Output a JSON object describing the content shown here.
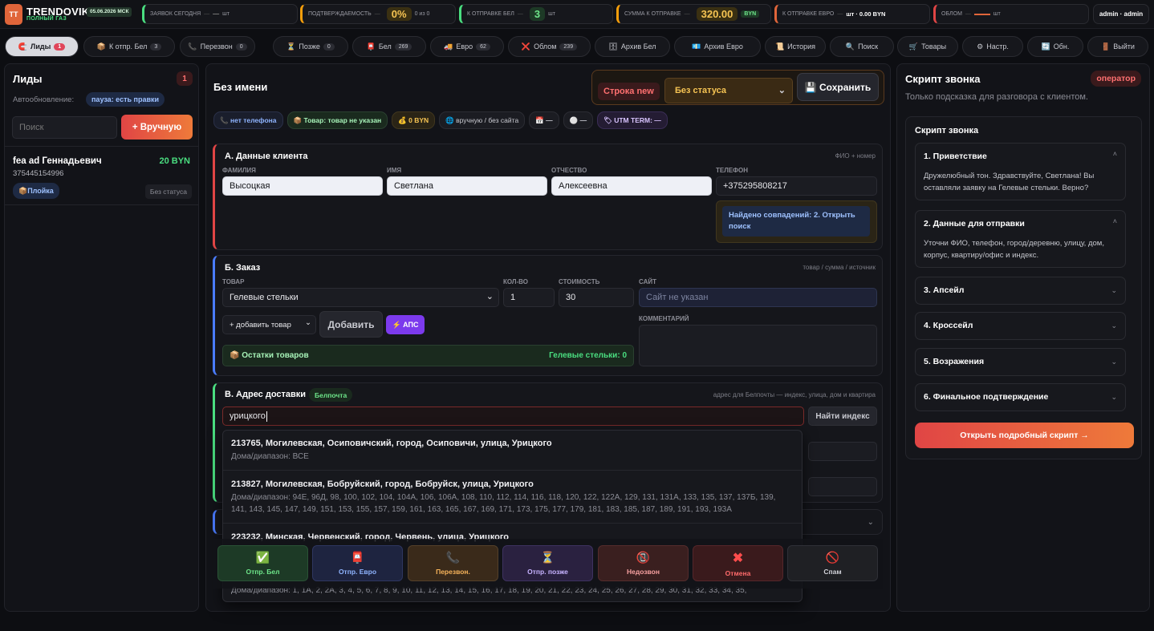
{
  "topbar": {
    "logo": "TT",
    "brand": "TRENDOVIK",
    "brand_sub": "ПОЛНЫЙ ГАЗ",
    "date": "05.06.2026 МСК",
    "stats": [
      {
        "label": "ЗАЯВОК СЕГОДНЯ",
        "value": "—",
        "unit": "шт"
      },
      {
        "label": "ПОДТВЕРЖДАЕМОСТЬ",
        "value": "0%",
        "unit": "0 из 0"
      },
      {
        "label": "К ОТПРАВКЕ БЕЛ",
        "value": "3",
        "unit": "шт"
      },
      {
        "label": "СУММА К ОТПРАВКЕ",
        "value": "320.00",
        "unit": "BYN"
      },
      {
        "label": "К ОТПРАВКЕ ЕВРО",
        "value": "шт · 0.00 BYN"
      },
      {
        "label": "ОБЛОМ",
        "value": "—",
        "unit": "шт"
      }
    ],
    "user": "admin · admin",
    "colors": {
      "green": "#4ade80",
      "orange": "#f59e0b",
      "red": "#e04545"
    }
  },
  "tabs": [
    {
      "icon": "🧲",
      "label": "Лиды",
      "count": "1"
    },
    {
      "icon": "📦",
      "label": "К отпр. Бел",
      "count": "3"
    },
    {
      "icon": "📞",
      "label": "Перезвон",
      "count": "0"
    },
    {
      "icon": "⏳",
      "label": "Позже",
      "count": "0"
    },
    {
      "icon": "📮",
      "label": "Бел",
      "count": "269"
    },
    {
      "icon": "🚚",
      "label": "Евро",
      "count": "62"
    },
    {
      "icon": "❌",
      "label": "Облом",
      "count": "239"
    },
    {
      "icon": "🗄",
      "label": "Архив Бел",
      "count": ""
    },
    {
      "icon": "💶",
      "label": "Архив Евро",
      "count": ""
    },
    {
      "icon": "📜",
      "label": "История",
      "count": ""
    },
    {
      "icon": "🔍",
      "label": "Поиск",
      "count": ""
    },
    {
      "icon": "🛒",
      "label": "Товары",
      "count": ""
    },
    {
      "icon": "⚙",
      "label": "Настр.",
      "count": ""
    },
    {
      "icon": "🔄",
      "label": "Обн.",
      "count": ""
    },
    {
      "icon": "🚪",
      "label": "Выйти",
      "count": ""
    }
  ],
  "leads": {
    "title": "Лиды",
    "count": "1",
    "autoupdate_label": "Автообновление:",
    "autoupdate_state": "пауза: есть правки",
    "search_placeholder": "Поиск",
    "manual_button": "+ Вручную",
    "items": [
      {
        "name": "fea ad Геннадьевич",
        "phone": "375445154996",
        "amount": "20 BYN",
        "product": "📦Плойка",
        "status": "Без статуса"
      }
    ]
  },
  "editor": {
    "title": "Без имени",
    "row_badge": "Строка new",
    "status_select": "Без статуса",
    "save_button": "💾 Сохранить",
    "chips": [
      {
        "text": "📞 нет телефона",
        "color": "#8fb4ff"
      },
      {
        "text": "📦 Товар: товар не указан",
        "color": "#a7f3b8"
      },
      {
        "text": "💰 0 BYN",
        "color": "#f6c453"
      },
      {
        "text": "🌐 вручную / без сайта",
        "color": "#c8c9d0"
      },
      {
        "text": "📅 —",
        "color": "#c8c9d0"
      },
      {
        "text": "⚪ —",
        "color": "#c8c9d0"
      },
      {
        "text": "🏷 UTM TERM: —",
        "color": "#d9c4ff"
      }
    ],
    "client": {
      "title": "А. Данные клиента",
      "hint": "ФИО + номер",
      "labels": [
        "ФАМИЛИЯ",
        "ИМЯ",
        "ОТЧЕСТВО",
        "ТЕЛЕФОН"
      ],
      "values": [
        "Высоцкая",
        "Светлана",
        "Алексеевна",
        "+375295808217"
      ],
      "match_notice": "Найдено совпадений: 2. Открыть поиск"
    },
    "order": {
      "title": "Б. Заказ",
      "hint": "товар / сумма / источник",
      "labels": [
        "ТОВАР",
        "КОЛ-ВО",
        "СТОИМОСТЬ",
        "САЙТ",
        "КОММЕНТАРИЙ"
      ],
      "product": "Гелевые стельки",
      "qty": "1",
      "price": "30",
      "site_placeholder": "Сайт не указан",
      "add_product_select": "+ добавить товар",
      "add_button": "Добавить",
      "aps_button": "⚡ АПС",
      "stock_label": "📦 Остатки товаров",
      "stock_value": "Гелевые стельки: 0"
    },
    "address": {
      "title": "В. Адрес доставки",
      "badge": "Белпочта",
      "hint": "адрес для Белпочты — индекс, улица, дом и квартира",
      "query": "урицкого",
      "find_button": "Найти индекс",
      "suggestions": [
        {
          "title": "213765, Могилевская, Осиповичский, город, Осиповичи, улица, Урицкого",
          "houses": "Дома/диапазон: ВСЕ"
        },
        {
          "title": "213827, Могилевская, Бобруйский, город, Бобруйск, улица, Урицкого",
          "houses": "Дома/диапазон: 94Е, 96Д, 98, 100, 102, 104, 104А, 106, 106А, 108, 110, 112, 114, 116, 118, 120, 122, 122А, 129, 131, 131А, 133, 135, 137, 137Б, 139, 141, 143, 145, 147, 149, 151, 153, 155, 157, 159, 161, 163, 165, 167, 169, 171, 173, 175, 177, 179, 181, 183, 185, 187, 189, 191, 193, 193А"
        },
        {
          "title": "223232, Минская, Червенский, город, Червень, улица, Урицкого",
          "houses": ""
        }
      ],
      "tail_houses": "Дома/диапазон: 1, 1А, 2, 2А, 3, 4, 5, 6, 7, 8, 9, 10, 11, 12, 13, 14, 15, 16, 17, 18, 19, 20, 21, 22, 23, 24, 25, 26, 27, 28, 29, 30, 31, 32, 33, 34, 35,"
    },
    "actions": [
      {
        "icon": "✅",
        "label": "Отпр. Бел",
        "bg": "#1d3a26",
        "fg": "#6ee68a"
      },
      {
        "icon": "📮",
        "label": "Отпр. Евро",
        "bg": "#1e2440",
        "fg": "#8fb4ff"
      },
      {
        "icon": "📞",
        "label": "Перезвон.",
        "bg": "#3a2a1a",
        "fg": "#f6b35a"
      },
      {
        "icon": "⏳",
        "label": "Отпр. позже",
        "bg": "#2a2140",
        "fg": "#c7b3ff"
      },
      {
        "icon": "📵",
        "label": "Недозвон",
        "bg": "#3a1f1f",
        "fg": "#f6a0a0"
      },
      {
        "icon": "✖",
        "label": "Отмена",
        "bg": "#3a1a1c",
        "fg": "#ff6b6b"
      },
      {
        "icon": "🚫",
        "label": "Спам",
        "bg": "#1f2024",
        "fg": "#d0d1d8"
      }
    ]
  },
  "script": {
    "title": "Скрипт звонка",
    "role_badge": "оператор",
    "subtitle": "Только подсказка для разговора с клиентом.",
    "inner_title": "Скрипт звонка",
    "steps": [
      {
        "title": "1. Приветствие",
        "body": "Дружелюбный тон. Здравствуйте, Светлана! Вы оставляли заявку на Гелевые стельки. Верно?",
        "open": true
      },
      {
        "title": "2. Данные для отправки",
        "body": "Уточни ФИО, телефон, город/деревню, улицу, дом, корпус, квартиру/офис и индекс.",
        "open": true
      },
      {
        "title": "3. Апсейл",
        "body": "",
        "open": false
      },
      {
        "title": "4. Кроссейл",
        "body": "",
        "open": false
      },
      {
        "title": "5. Возражения",
        "body": "",
        "open": false
      },
      {
        "title": "6. Финальное подтверждение",
        "body": "",
        "open": false
      }
    ],
    "open_button": "Открыть подробный скрипт →"
  }
}
